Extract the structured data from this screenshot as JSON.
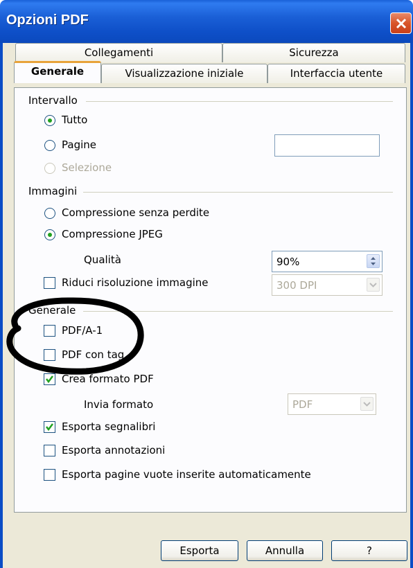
{
  "window": {
    "title": "Opzioni PDF"
  },
  "tabs": {
    "row1": [
      "Collegamenti",
      "Sicurezza"
    ],
    "row2": [
      "Generale",
      "Visualizzazione iniziale",
      "Interfaccia utente"
    ]
  },
  "range": {
    "heading": "Intervallo",
    "all": "Tutto",
    "pages": "Pagine",
    "pages_value": "",
    "selection": "Selezione"
  },
  "images": {
    "heading": "Immagini",
    "lossless": "Compressione senza perdite",
    "jpeg": "Compressione JPEG",
    "quality_label": "Qualità",
    "quality_value": "90%",
    "reduce_label": "Riduci risoluzione immagine",
    "reduce_value": "300 DPI"
  },
  "general": {
    "heading": "Generale",
    "pdfa": "PDF/A-1",
    "tagged": "PDF con tag",
    "create_form": "Crea formato PDF",
    "submit_label": "Invia formato",
    "submit_value": "PDF",
    "bookmarks": "Esporta segnalibri",
    "notes": "Esporta annotazioni",
    "empty_pages": "Esporta pagine vuote inserite automaticamente"
  },
  "buttons": {
    "export": "Esporta",
    "cancel": "Annulla",
    "help": "?"
  },
  "colors": {
    "titlebar": "#0b49bd",
    "active_tab_accent": "#e8a33a",
    "check_green": "#21a121"
  }
}
